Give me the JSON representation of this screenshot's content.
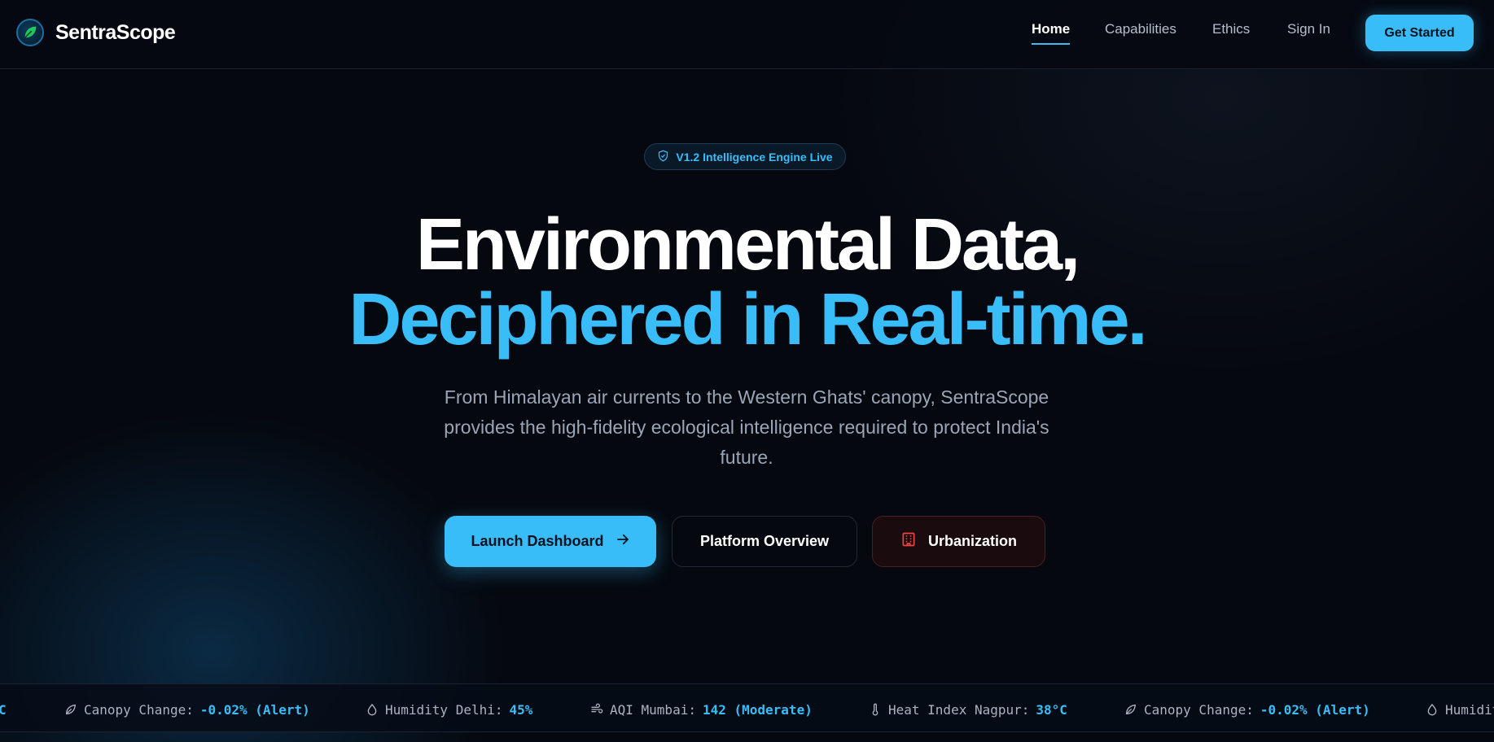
{
  "brand": {
    "name": "SentraScope"
  },
  "nav": {
    "links": [
      "Home",
      "Capabilities",
      "Ethics",
      "Sign In"
    ],
    "active": "Home",
    "cta": "Get Started"
  },
  "hero": {
    "badge": "V1.2 Intelligence Engine Live",
    "title_line1": "Environmental Data,",
    "title_line2": "Deciphered in Real-time.",
    "subtitle": "From Himalayan air currents to the Western Ghats' canopy, SentraScope provides the high-fidelity ecological intelligence required to protect India's future.",
    "buttons": {
      "launch": "Launch Dashboard",
      "overview": "Platform Overview",
      "urbanization": "Urbanization"
    }
  },
  "ticker": {
    "leading_fragment": "C",
    "items": [
      {
        "icon": "leaf-icon",
        "label": "Canopy Change:",
        "value": "-0.02% (Alert)"
      },
      {
        "icon": "droplet-icon",
        "label": "Humidity Delhi:",
        "value": "45%"
      },
      {
        "icon": "wind-icon",
        "label": "AQI Mumbai:",
        "value": "142 (Moderate)"
      },
      {
        "icon": "thermometer-icon",
        "label": "Heat Index Nagpur:",
        "value": "38°C"
      },
      {
        "icon": "leaf-icon",
        "label": "Canopy Change:",
        "value": "-0.02% (Alert)"
      }
    ],
    "trailing_fragment": "Humidit"
  },
  "colors": {
    "accent": "#38bdf8",
    "background": "#05080f",
    "danger": "#ef4444"
  }
}
